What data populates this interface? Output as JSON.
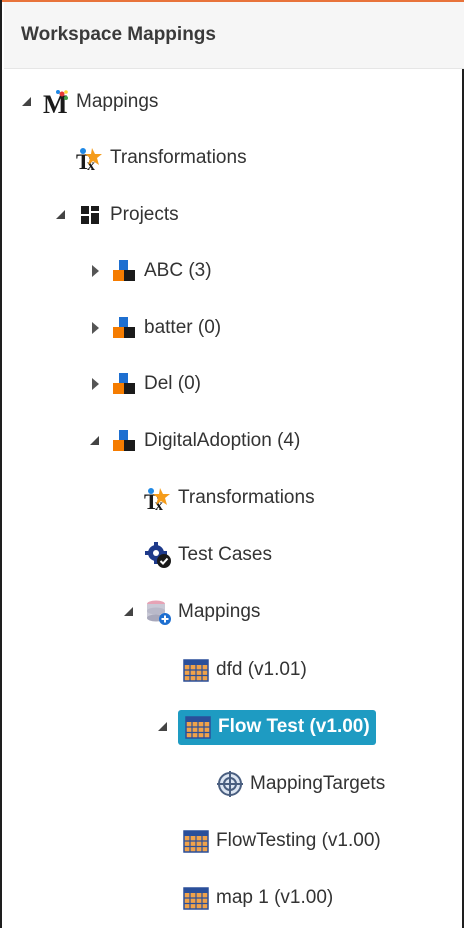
{
  "panel": {
    "title": "Workspace Mappings"
  },
  "colors": {
    "accent": "#e8733a",
    "selection": "#1e9bc2"
  },
  "tree": [
    {
      "label": "Mappings",
      "icon": "mappings-m-icon",
      "state": "expanded"
    },
    {
      "label": "Transformations",
      "icon": "transformations-icon",
      "state": "leaf"
    },
    {
      "label": "Projects",
      "icon": "projects-grid-icon",
      "state": "expanded"
    },
    {
      "label": "ABC (3)",
      "icon": "project-folder-icon",
      "state": "collapsed"
    },
    {
      "label": "batter (0)",
      "icon": "project-folder-icon",
      "state": "collapsed"
    },
    {
      "label": "Del (0)",
      "icon": "project-folder-icon",
      "state": "collapsed"
    },
    {
      "label": "DigitalAdoption (4)",
      "icon": "project-folder-icon",
      "state": "expanded"
    },
    {
      "label": "Transformations",
      "icon": "transformations-icon",
      "state": "leaf"
    },
    {
      "label": "Test Cases",
      "icon": "test-cases-gear-icon",
      "state": "leaf"
    },
    {
      "label": "Mappings",
      "icon": "mappings-database-icon",
      "state": "expanded"
    },
    {
      "label": "dfd (v1.01)",
      "icon": "mapping-table-icon",
      "state": "leaf"
    },
    {
      "label": "Flow Test (v1.00)",
      "icon": "mapping-table-icon",
      "state": "expanded",
      "selected": true
    },
    {
      "label": "MappingTargets",
      "icon": "target-icon",
      "state": "leaf"
    },
    {
      "label": "FlowTesting (v1.00)",
      "icon": "mapping-table-icon",
      "state": "leaf"
    },
    {
      "label": "map 1 (v1.00)",
      "icon": "mapping-table-icon",
      "state": "leaf"
    }
  ]
}
